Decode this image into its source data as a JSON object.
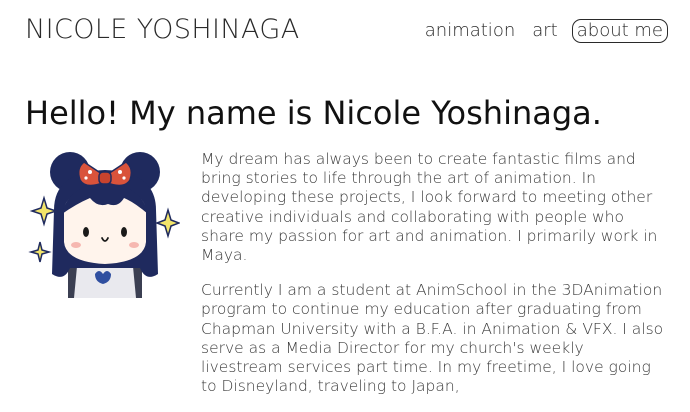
{
  "site": {
    "title": "NICOLE YOSHINAGA"
  },
  "nav": {
    "items": [
      {
        "label": "animation"
      },
      {
        "label": "art"
      },
      {
        "label": "about me",
        "active": true
      }
    ]
  },
  "main": {
    "headline": "Hello! My name is Nicole Yoshinaga.",
    "paragraphs": [
      "My dream has always been to create fantastic films and bring stories to life through the art of animation. In developing these projects, I look forward to meeting other creative individuals and collaborating with people who share my passion for art and animation. I primarily work in Maya.",
      "Currently I am a student at AnimSchool in the 3DAnimation program to continue my education after graduating from Chapman University with a B.F.A. in Animation & VFX. I also serve as a Media Director for my church's weekly livestream services part time. In my freetime, I love going to Disneyland, traveling to Japan,"
    ]
  },
  "avatar": {
    "icon": "cartoon-girl-avatar-icon"
  },
  "colors": {
    "bow": "#d9533b",
    "hair": "#1f2a5e",
    "sparkle": "#f2e46a",
    "text": "#2a2a2a"
  }
}
